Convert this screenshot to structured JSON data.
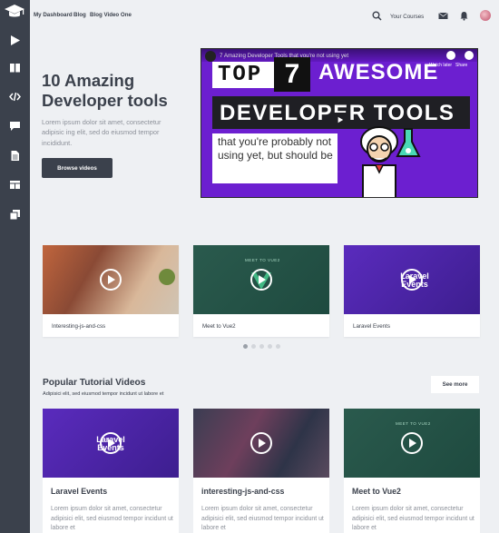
{
  "topnav": {
    "links": [
      "My Dashboard",
      "Blog",
      "Blog Video One"
    ],
    "your_courses": "Your Courses"
  },
  "sidebar": {
    "items": [
      "logo-icon",
      "play-icon",
      "book-icon",
      "code-icon",
      "chat-icon",
      "document-icon",
      "layout-icon",
      "copy-icon"
    ]
  },
  "hero": {
    "title": "10 Amazing Developer tools",
    "description": "Lorem ipsum dolor sit amet, consectetur adipisic ing elit, sed do eiusmod tempor incididunt.",
    "button": "Browse videos"
  },
  "video": {
    "title": "7 Amazing Developer Tools that you're not using yet",
    "line1a": "TOP",
    "line1b": "7",
    "line1c": "AWESOME",
    "line2": "DEVELOPER TOOLS",
    "line3": "that you're probably not using yet, but should be",
    "watch_later": "Watch later",
    "share": "Share"
  },
  "carousel": {
    "cards": [
      {
        "label": "Interesting-js-and-css"
      },
      {
        "label": "Meet to Vue2"
      },
      {
        "label": "Laravel Events"
      }
    ],
    "thumb_texts": [
      "",
      "MEET TO VUE2",
      "Laravel Events"
    ],
    "page_dots": 5,
    "active_dot": 0
  },
  "popular": {
    "title": "Popular Tutorial Videos",
    "subtitle": "Adipisici elit, sed eiusmod tempor incidunt ut labore et",
    "see_more": "See more",
    "cards": [
      {
        "title": "Laravel Events",
        "desc": "Lorem ipsum dolor sit amet, consectetur adipisici elit, sed eiusmod tempor incidunt ut labore et",
        "thumb_text": "Laravel Events"
      },
      {
        "title": "interesting-js-and-css",
        "desc": "Lorem ipsum dolor sit amet, consectetur adipisici elit, sed eiusmod tempor incidunt ut labore et",
        "thumb_text": ""
      },
      {
        "title": "Meet to Vue2",
        "desc": "Lorem ipsum dolor sit amet, consectetur adipisici elit, sed eiusmod tempor incidunt ut labore et",
        "thumb_text": "MEET TO VUE2"
      }
    ]
  },
  "colors": {
    "sidebar": "#3b414c",
    "background": "#eef0f3",
    "accent_purple": "#6c1fd0",
    "vue_green": "#2f6b5a"
  }
}
